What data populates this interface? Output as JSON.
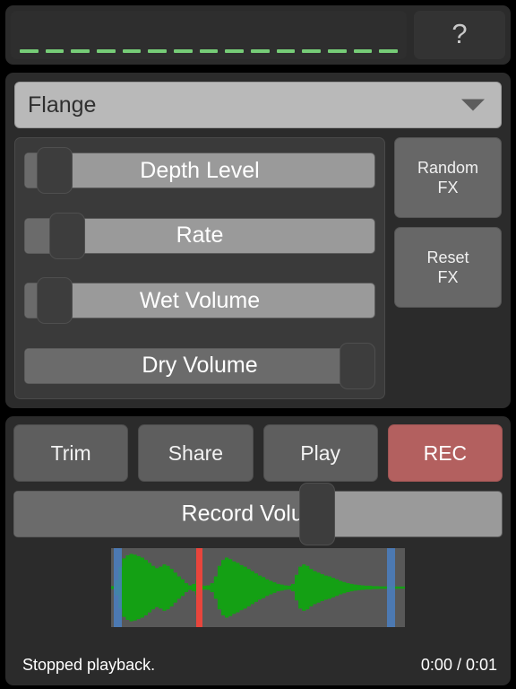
{
  "meter": {
    "name": "input-level-meter",
    "dash_count": 15,
    "dash_color": "#76cc77",
    "active": false
  },
  "help": {
    "label": "?",
    "icon": "question-mark-icon"
  },
  "fx": {
    "selected_effect": "Flange",
    "caret_icon": "chevron-down-icon",
    "sliders": [
      {
        "label": "Depth Level",
        "value_percent": 4
      },
      {
        "label": "Rate",
        "value_percent": 8
      },
      {
        "label": "Wet Volume",
        "value_percent": 4
      },
      {
        "label": "Dry Volume",
        "value_percent": 100
      }
    ],
    "buttons": [
      {
        "label": "Random\nFX",
        "line1": "Random",
        "line2": "FX"
      },
      {
        "label": "Reset\nFX",
        "line1": "Reset",
        "line2": "FX"
      }
    ]
  },
  "transport": {
    "buttons": [
      {
        "label": "Trim",
        "style": "normal"
      },
      {
        "label": "Share",
        "style": "normal"
      },
      {
        "label": "Play",
        "style": "normal"
      },
      {
        "label": "REC",
        "style": "record",
        "color": "#b3605f"
      }
    ],
    "record_volume": {
      "label": "Record Volume",
      "value_percent": 63
    }
  },
  "waveform": {
    "background": "#585858",
    "wave_color": "#14a014",
    "selection_marker_color": "#4a7fc1",
    "playhead_color": "#e8453c",
    "selection_start_percent": 1,
    "selection_end_percent": 94,
    "playhead_percent": 29,
    "envelope": [
      0.04,
      0.2,
      0.55,
      0.78,
      0.86,
      0.9,
      0.88,
      0.84,
      0.8,
      0.74,
      0.66,
      0.58,
      0.52,
      0.56,
      0.62,
      0.58,
      0.5,
      0.4,
      0.3,
      0.22,
      0.12,
      0.06,
      0.1,
      0.2,
      0.08,
      0.05,
      0.06,
      0.12,
      0.3,
      0.58,
      0.74,
      0.8,
      0.76,
      0.7,
      0.66,
      0.6,
      0.56,
      0.5,
      0.44,
      0.38,
      0.32,
      0.28,
      0.22,
      0.18,
      0.14,
      0.1,
      0.08,
      0.06,
      0.05,
      0.1,
      0.34,
      0.56,
      0.62,
      0.58,
      0.5,
      0.44,
      0.4,
      0.36,
      0.32,
      0.3,
      0.26,
      0.22,
      0.18,
      0.15,
      0.12,
      0.1,
      0.08,
      0.07,
      0.06,
      0.05,
      0.05,
      0.04,
      0.04,
      0.03,
      0.03,
      0.02,
      0.02,
      0.02,
      0.02,
      0.02
    ]
  },
  "status": {
    "message": "Stopped playback.",
    "time": "0:00 / 0:01"
  }
}
